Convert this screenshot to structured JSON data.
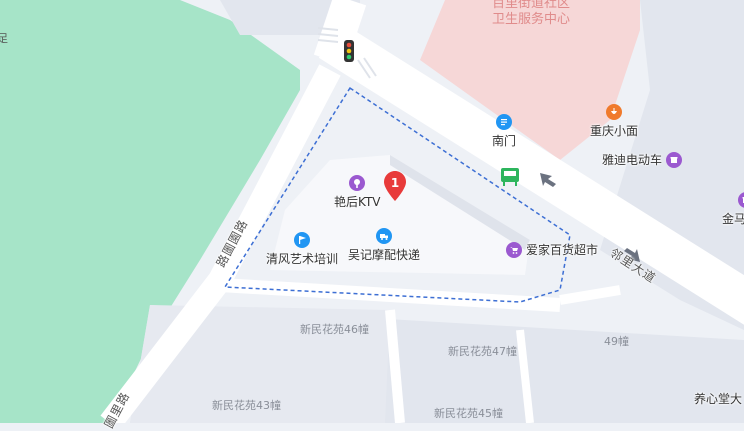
{
  "colors": {
    "background": "#eef1f6",
    "park": "#a6e4c8",
    "block": "#e2e6ee",
    "hospital": "#f6d7d7",
    "road": "#ffffff",
    "boundary": "#3d6fd4",
    "pin": "#e83a3a",
    "poi_purple": "#9b59d0",
    "poi_blue": "#2196f3",
    "poi_orange": "#f07a2c",
    "poi_green": "#2db55d"
  },
  "pin": {
    "number": "1"
  },
  "pois": {
    "ktv": {
      "label": "艳后KTV",
      "icon": "microphone-icon"
    },
    "art": {
      "label": "清风艺术培训",
      "icon": "flag-icon"
    },
    "express": {
      "label": "吴记摩配快递",
      "icon": "truck-icon"
    },
    "supermarket": {
      "label": "爱家百货超市",
      "icon": "shopping-cart-icon"
    },
    "south_gate": {
      "label": "南门",
      "icon": "gate-icon"
    },
    "noodles": {
      "label": "重庆小面",
      "icon": "food-icon"
    },
    "ebike": {
      "label": "雅迪电动车",
      "icon": "shop-icon"
    },
    "jinma": {
      "label": "金马",
      "icon": "shop-icon"
    },
    "yangxin": {
      "label": "养心堂大",
      "icon": "none"
    }
  },
  "hospital": {
    "line1": "百里街道社区",
    "line2": "卫生服务中心"
  },
  "residential": {
    "b46": "新民花苑46幢",
    "b47": "新民花苑47幢",
    "b49": "49幢",
    "b43": "新民花苑43幢",
    "b45": "新民花苑45幢"
  },
  "roads": {
    "linli": "邻里大道",
    "west_top": "路圖園路",
    "west_bottom": "圖里路",
    "edge_fragment": "足"
  },
  "icons": {
    "traffic_light": "traffic-light-icon",
    "bus_stop": "bus-stop-icon",
    "direction_arrow": "arrow-icon"
  }
}
